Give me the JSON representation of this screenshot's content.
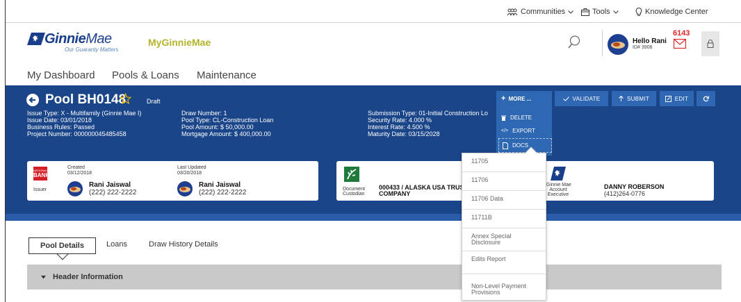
{
  "utility_nav": {
    "communities": "Communities",
    "tools": "Tools",
    "knowledge_center": "Knowledge Center"
  },
  "header": {
    "logo_word_bold": "Ginnie",
    "logo_word_light": "Mae",
    "logo_tagline": "Our Guaranty Matters",
    "app_name": "MyGinnieMae",
    "greeting": "Hello Rani",
    "user_id": "ID# 3908",
    "notification_count": "6143"
  },
  "main_nav": {
    "items": [
      "My Dashboard",
      "Pools & Loans",
      "Maintenance"
    ]
  },
  "pool": {
    "title": "Pool BH0148",
    "status": "Draft",
    "col1": [
      "Issue Type: X - Multifamily (Ginnie Mae I)",
      "Issue Date: 03/01/2018",
      "Business Rules: Passed",
      "Project Number: 000000045485458"
    ],
    "col2": [
      "Draw Number: 1",
      "Pool Type: CL-Construction Loan",
      "Pool Amount: $ 50,000.00",
      "Mortgage Amount: $ 400,000.00"
    ],
    "col3": [
      "Submission Type: 01-Initial Construction Lo",
      "Security Rate: 4.000 %",
      "Interest Rate: 4.500 %",
      "Maturity Date: 03/15/2028"
    ]
  },
  "actions": {
    "more": "MORE ...",
    "delete": "DELETE",
    "export": "EXPORT",
    "docs": "DOCS",
    "validate": "VALIDATE",
    "submit": "SUBMIT",
    "edit": "EDIT"
  },
  "issuer_card": {
    "logo_line1": "NATIONAL",
    "logo_line2": "BANK",
    "label": "Issuer",
    "created_label": "Created",
    "created_date": "03/12/2018",
    "created_name": "Rani Jaiswal",
    "created_phone": "(222) 222-2222",
    "updated_label": "Last Updated",
    "updated_date": "03/20/2018",
    "updated_name": "Rani Jaiswal",
    "updated_phone": "(222) 222-2222"
  },
  "custodian_card": {
    "label_line1": "Document",
    "label_line2": "Custodian",
    "name_line1": "000433 / ALASKA USA TRUS",
    "name_line2": "COMPANY"
  },
  "executive_card": {
    "label_line1": "Ginnie Mae",
    "label_line2": "Account",
    "label_line3": "Executive",
    "name": "DANNY ROBERSON",
    "phone": "(412)264-0776"
  },
  "docs_menu": {
    "items": [
      [
        "11705"
      ],
      [
        "11706"
      ],
      [
        "11706 Data"
      ],
      [
        "11711B"
      ],
      [
        "Annex Special",
        "Disclosure"
      ],
      [
        "Edits Report"
      ],
      [
        "Non-Level Payment",
        "Provisions"
      ]
    ]
  },
  "tabs": {
    "items": [
      "Pool Details",
      "Loans",
      "Draw History Details"
    ]
  },
  "section": {
    "header_information": "Header Information"
  },
  "colors": {
    "brand_blue": "#1b4589",
    "button_blue": "#2f67b3",
    "app_name_olive": "#b3b42c",
    "alert_red": "#d22222",
    "star_gold": "#e8b400"
  }
}
